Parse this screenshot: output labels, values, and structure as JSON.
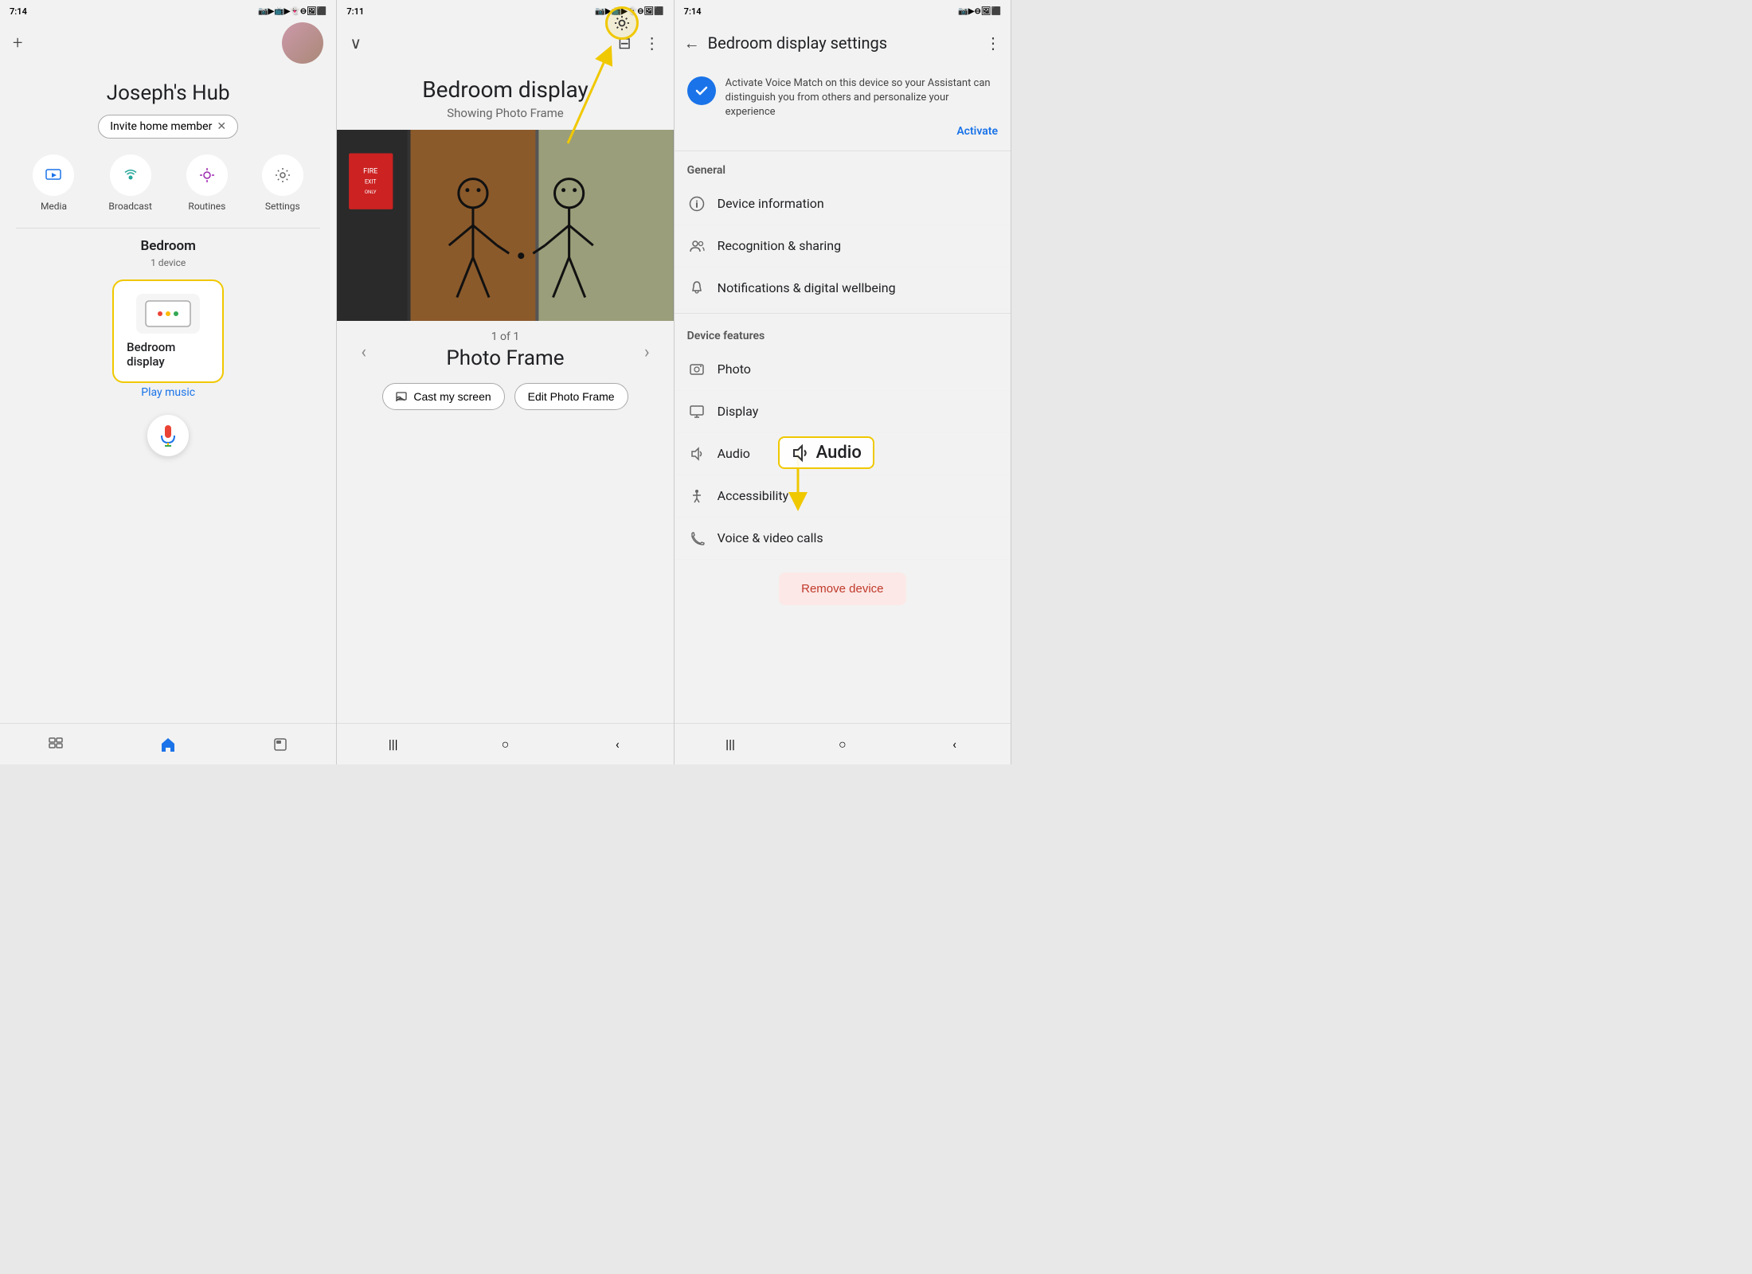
{
  "panel1": {
    "status_time": "7:14",
    "title": "Joseph's Hub",
    "invite_btn": "Invite home member",
    "quick_actions": [
      {
        "label": "Media",
        "icon": "▶"
      },
      {
        "label": "Broadcast",
        "icon": "📡"
      },
      {
        "label": "Routines",
        "icon": "☀"
      },
      {
        "label": "Settings",
        "icon": "⚙"
      }
    ],
    "section_title": "Bedroom",
    "section_sub": "1 device",
    "device_name": "Bedroom display",
    "play_music": "Play music",
    "bottom_nav": [
      "|||",
      "○",
      "‹"
    ]
  },
  "panel2": {
    "status_time": "7:11",
    "device_title": "Bedroom display",
    "subtitle": "Showing Photo Frame",
    "counter": "1 of 1",
    "photo_name": "Photo Frame",
    "cast_btn": "Cast my screen",
    "edit_btn": "Edit Photo Frame",
    "bottom_nav": [
      "|||",
      "○",
      "‹"
    ]
  },
  "panel3": {
    "status_time": "7:14",
    "page_title": "Bedroom display settings",
    "voice_match_text": "Activate Voice Match on this device so your Assistant can distinguish you from others and personalize your experience",
    "activate_label": "Activate",
    "general_section": "General",
    "settings_items": [
      {
        "icon": "ℹ",
        "label": "Device information"
      },
      {
        "icon": "👥",
        "label": "Recognition & sharing"
      },
      {
        "icon": "🔔",
        "label": "Notifications & digital wellbeing"
      }
    ],
    "device_features_section": "Device features",
    "feature_items": [
      {
        "icon": "🖼",
        "label": "Photo"
      },
      {
        "icon": "🖥",
        "label": "Display"
      },
      {
        "icon": "🔊",
        "label": "Audio"
      },
      {
        "icon": "♿",
        "label": "Accessibility"
      },
      {
        "icon": "📞",
        "label": "Voice & video calls"
      }
    ],
    "remove_device": "Remove device",
    "audio_highlight": "Audio",
    "bottom_nav": [
      "|||",
      "○",
      "‹"
    ]
  },
  "colors": {
    "yellow": "#f0c800",
    "blue": "#1a73e8",
    "red_remove": "#c0392b",
    "bg": "#f2f2f2"
  }
}
